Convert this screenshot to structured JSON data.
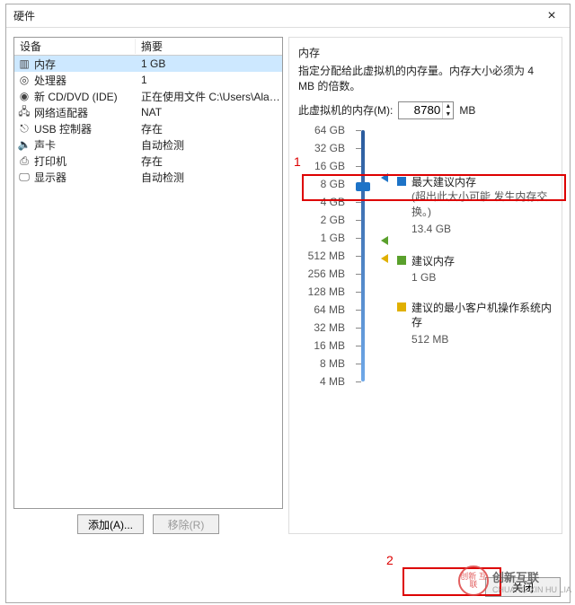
{
  "dialog": {
    "title": "硬件",
    "close_label": "×"
  },
  "hw_table": {
    "col_device": "设备",
    "col_summary": "摘要",
    "rows": [
      {
        "icon": "memory-icon",
        "name": "内存",
        "summary": "1 GB",
        "selected": true
      },
      {
        "icon": "cpu-icon",
        "name": "处理器",
        "summary": "1"
      },
      {
        "icon": "disc-icon",
        "name": "新 CD/DVD (IDE)",
        "summary": "正在使用文件 C:\\Users\\Alan..."
      },
      {
        "icon": "nic-icon",
        "name": "网络适配器",
        "summary": "NAT"
      },
      {
        "icon": "usb-icon",
        "name": "USB 控制器",
        "summary": "存在"
      },
      {
        "icon": "sound-icon",
        "name": "声卡",
        "summary": "自动检测"
      },
      {
        "icon": "printer-icon",
        "name": "打印机",
        "summary": "存在"
      },
      {
        "icon": "display-icon",
        "name": "显示器",
        "summary": "自动检测"
      }
    ]
  },
  "buttons": {
    "add": "添加(A)...",
    "remove": "移除(R)",
    "close": "关闭"
  },
  "memory": {
    "section_title": "内存",
    "desc": "指定分配给此虚拟机的内存量。内存大小必须为 4 MB 的倍数。",
    "field_label": "此虚拟机的内存(M):",
    "value": "8780",
    "unit": "MB",
    "scale": [
      "64 GB",
      "32 GB",
      "16 GB",
      "8 GB",
      "4 GB",
      "2 GB",
      "1 GB",
      "512 MB",
      "256 MB",
      "128 MB",
      "64 MB",
      "32 MB",
      "16 MB",
      "8 MB",
      "4 MB"
    ],
    "markers": {
      "max": {
        "label": "最大建议内存",
        "note": "(超出此大小可能\n发生内存交换。)",
        "value": "13.4 GB",
        "color": "#1d73c7"
      },
      "rec": {
        "label": "建议内存",
        "value": "1 GB",
        "color": "#5aa02c"
      },
      "min": {
        "label": "建议的最小客户机操作系统内存",
        "value": "512 MB",
        "color": "#e0b000"
      }
    }
  },
  "annotations": {
    "one": "1",
    "two": "2"
  },
  "watermark": {
    "text1": "创新互联",
    "text2": "CHUANG XIN HU LIA",
    "ball": "创新\n互联"
  }
}
